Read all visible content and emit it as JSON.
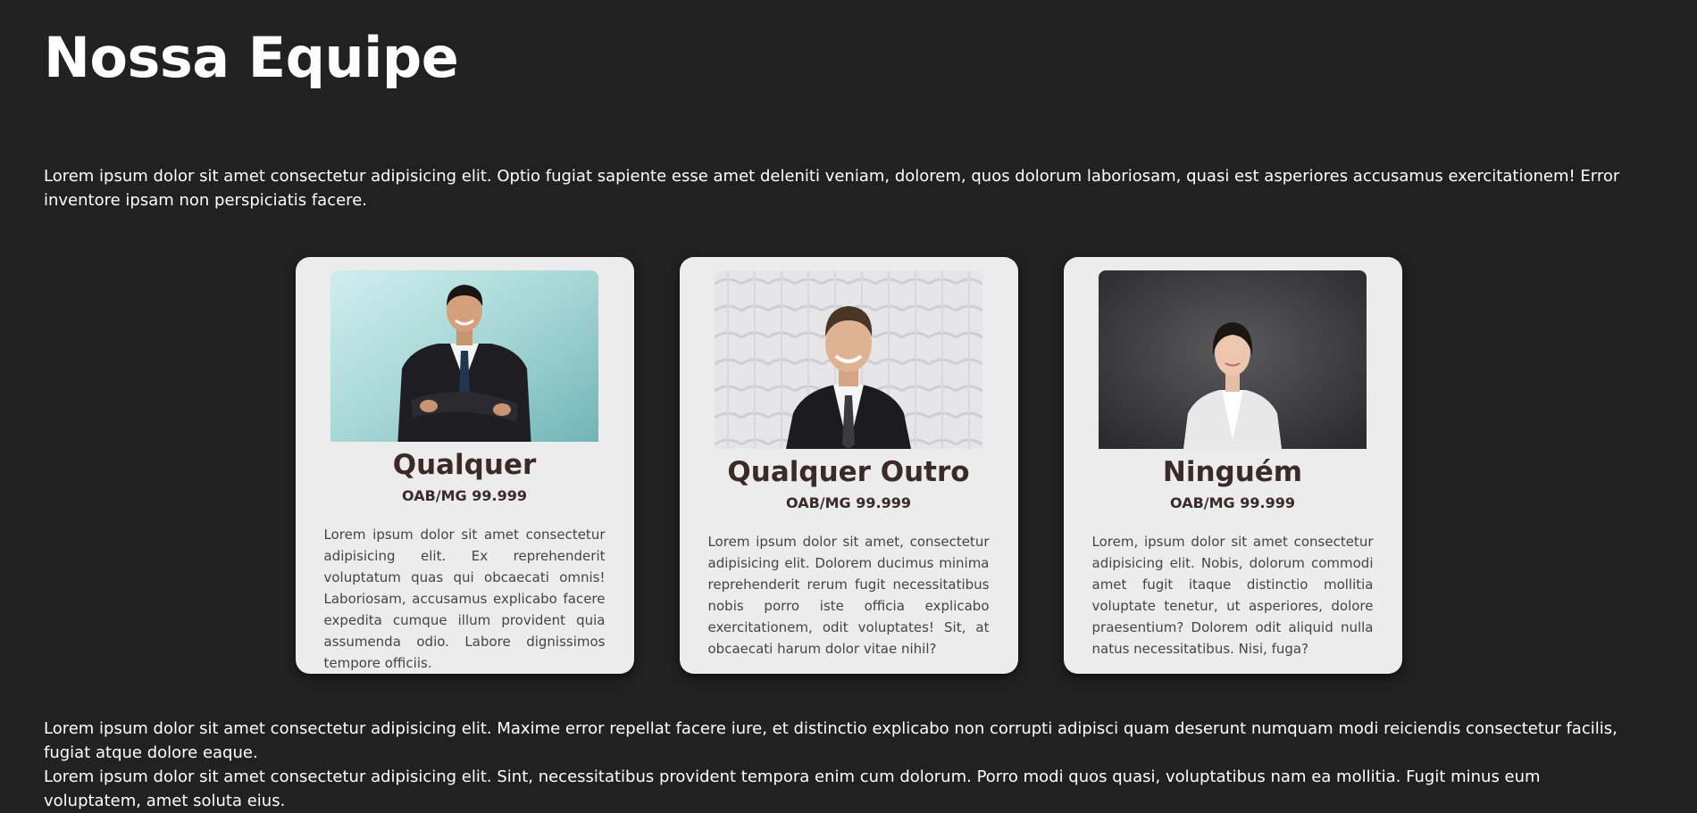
{
  "page": {
    "title": "Nossa Equipe",
    "intro": "Lorem ipsum dolor sit amet consectetur adipisicing elit. Optio fugiat sapiente esse amet deleniti veniam, dolorem, quos dolorum laboriosam, quasi est asperiores accusamus exercitationem! Error inventore ipsam non perspiciatis facere."
  },
  "team": [
    {
      "name": "Qualquer",
      "oab": "OAB/MG 99.999",
      "bio": "Lorem ipsum dolor sit amet consectetur adipisicing elit. Ex reprehenderit voluptatum quas qui obcaecati omnis! Laboriosam, accusamus explicabo facere expedita cumque illum provident quia assumenda odio. Labore dignissimos tempore officiis."
    },
    {
      "name": "Qualquer Outro",
      "oab": "OAB/MG 99.999",
      "bio": "Lorem ipsum dolor sit amet, consectetur adipisicing elit. Dolorem ducimus minima reprehenderit rerum fugit necessitatibus nobis porro iste officia explicabo exercitationem, odit voluptates! Sit, at obcaecati harum dolor vitae nihil?"
    },
    {
      "name": "Ninguém",
      "oab": "OAB/MG 99.999",
      "bio": "Lorem, ipsum dolor sit amet consectetur adipisicing elit. Nobis, dolorum commodi amet fugit itaque distinctio mollitia voluptate tenetur, ut asperiores, dolore praesentium? Dolorem odit aliquid nulla natus necessitatibus. Nisi, fuga?"
    }
  ],
  "outro": {
    "p1": "Lorem ipsum dolor sit amet consectetur adipisicing elit. Maxime error repellat facere iure, et distinctio explicabo non corrupti adipisci quam deserunt numquam modi reiciendis consectetur facilis, fugiat atque dolore eaque.",
    "p2": "Lorem ipsum dolor sit amet consectetur adipisicing elit. Sint, necessitatibus provident tempora enim cum dolorum. Porro modi quos quasi, voluptatibus nam ea mollitia. Fugit minus eum voluptatem, amet soluta eius."
  },
  "colors": {
    "background": "#212121",
    "card": "#ececec",
    "heading_text": "#3a2a28"
  }
}
